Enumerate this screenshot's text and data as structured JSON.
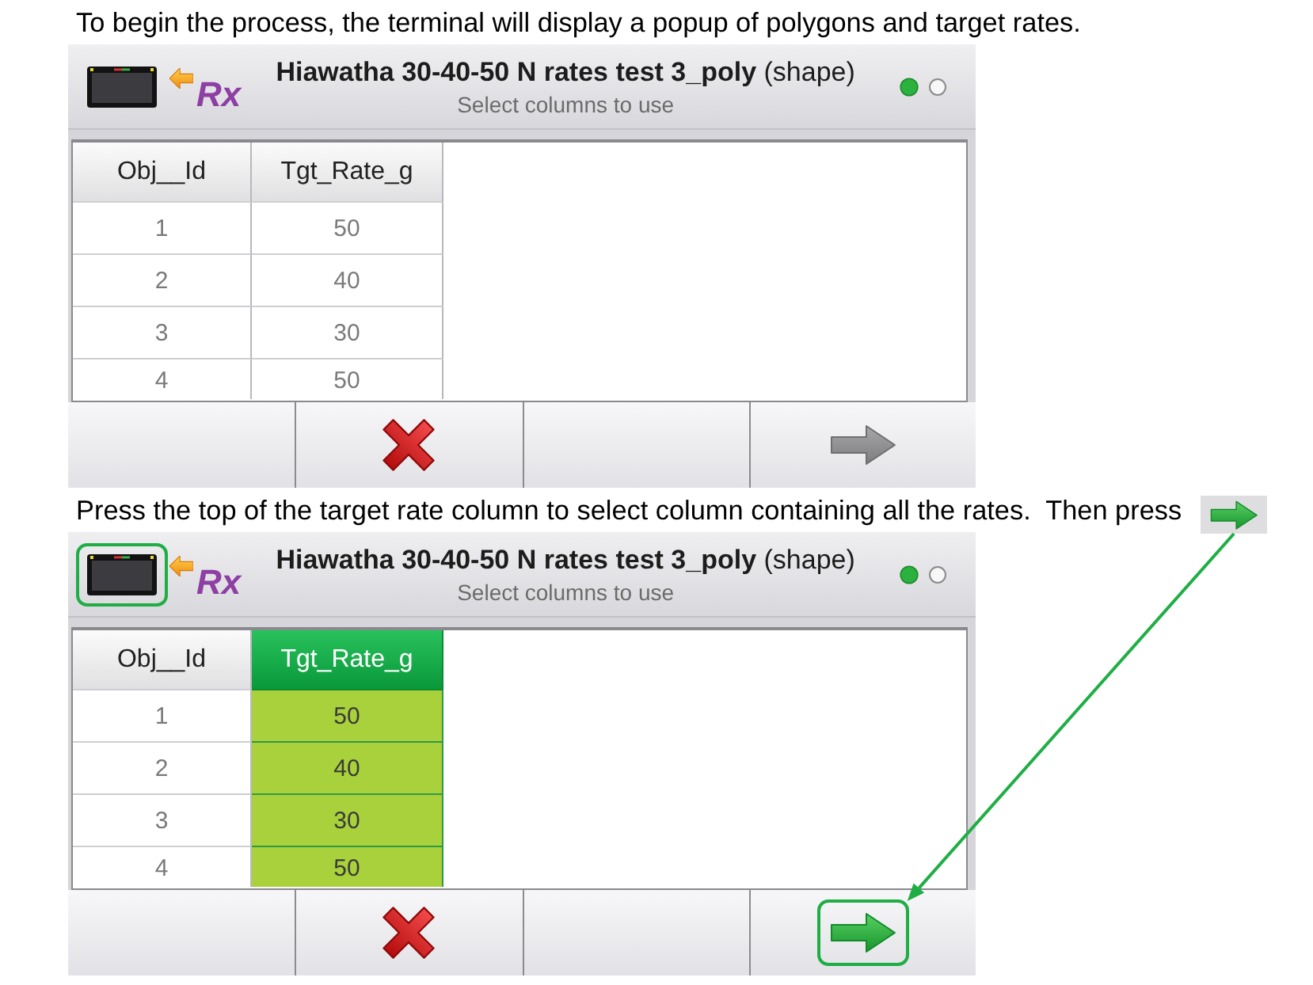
{
  "panels": [
    {
      "caption": "To begin the process, the terminal will display a popup of polygons and target rates.",
      "annotated": false,
      "header": {
        "logo_text": "Rx",
        "title": "**Hiawatha 30-40-50 N rates test 3_poly** (shape)",
        "subtitle": "Select columns to use",
        "page_dots": [
          {
            "selected": true
          },
          {
            "selected": false
          }
        ]
      },
      "table": {
        "columns": [
          {
            "label": "Obj__Id",
            "selected": false
          },
          {
            "label": "Tgt_Rate_g",
            "selected": false
          }
        ],
        "rows": [
          [
            "1",
            "50"
          ],
          [
            "2",
            "40"
          ],
          [
            "3",
            "30"
          ],
          [
            "4",
            "50"
          ]
        ]
      },
      "buttons": [
        {
          "kind": "blank"
        },
        {
          "kind": "cancel"
        },
        {
          "kind": "blank"
        },
        {
          "kind": "next",
          "enabled": false
        }
      ]
    },
    {
      "caption": "Press the top of the target rate column to select column containing all the rates.  Then press",
      "annotated": true,
      "header": {
        "logo_text": "Rx",
        "title": "**Hiawatha 30-40-50 N rates test 3_poly** (shape)",
        "subtitle": "Select columns to use",
        "page_dots": [
          {
            "selected": true
          },
          {
            "selected": false
          }
        ]
      },
      "table": {
        "columns": [
          {
            "label": "Obj__Id",
            "selected": false
          },
          {
            "label": "Tgt_Rate_g",
            "selected": true
          }
        ],
        "rows": [
          [
            "1",
            "50"
          ],
          [
            "2",
            "40"
          ],
          [
            "3",
            "30"
          ],
          [
            "4",
            "50"
          ]
        ]
      },
      "buttons": [
        {
          "kind": "blank"
        },
        {
          "kind": "cancel"
        },
        {
          "kind": "blank"
        },
        {
          "kind": "next",
          "enabled": true
        }
      ]
    }
  ]
}
